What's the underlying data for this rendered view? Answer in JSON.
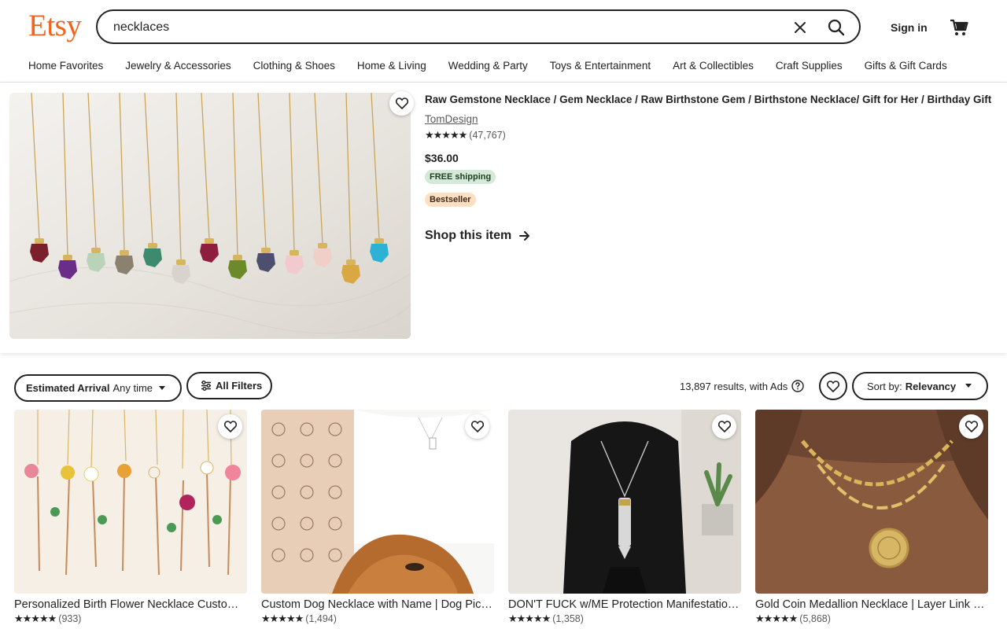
{
  "header": {
    "logo": "Etsy",
    "search_value": "necklaces",
    "sign_in": "Sign in"
  },
  "categories": [
    "Home Favorites",
    "Jewelry & Accessories",
    "Clothing & Shoes",
    "Home & Living",
    "Wedding & Party",
    "Toys & Entertainment",
    "Art & Collectibles",
    "Craft Supplies",
    "Gifts & Gift Cards"
  ],
  "featured": {
    "title": "Raw Gemstone Necklace / Gem Necklace / Raw Birthstone Gem / Birthstone Necklace/ Gift for Her / Birthday Gift",
    "shop": "TomDesign",
    "stars": "★★★★★",
    "reviews": "(47,767)",
    "price": "$36.00",
    "shipping_badge": "FREE shipping",
    "bestseller_badge": "Bestseller",
    "cta": "Shop this item",
    "gem_colors": [
      "#7a1f2b",
      "#6a2d8a",
      "#b9d3b9",
      "#8a8171",
      "#3e8a6e",
      "#d8d4cd",
      "#8e1e3d",
      "#6c8a2a",
      "#4c4f6e",
      "#f2c9cd",
      "#f0cfc8",
      "#d9a843",
      "#2db2d5"
    ]
  },
  "filters": {
    "arrival_label": "Estimated Arrival",
    "arrival_value": "Any time",
    "all_filters": "All Filters",
    "results": "13,897 results, with Ads",
    "sort_label": "Sort by:",
    "sort_value": "Relevancy"
  },
  "listings": [
    {
      "title": "Personalized Birth Flower Necklace Custom Name Necklace",
      "stars": "★★★★★",
      "reviews": "(933)"
    },
    {
      "title": "Custom Dog Necklace with Name | Dog Pic Necklace",
      "stars": "★★★★★",
      "reviews": "(1,494)"
    },
    {
      "title": "DON'T FUCK w/ME Protection Manifestation Necklace",
      "stars": "★★★★★",
      "reviews": "(1,358)"
    },
    {
      "title": "Gold Coin Medallion Necklace | Layer Link Chain",
      "stars": "★★★★★",
      "reviews": "(5,868)"
    }
  ],
  "colors": {
    "brand": "#f1641e",
    "text": "#222222",
    "ship_badge_bg": "#d4e9d7",
    "bestseller_badge_bg": "#fde0c2"
  }
}
